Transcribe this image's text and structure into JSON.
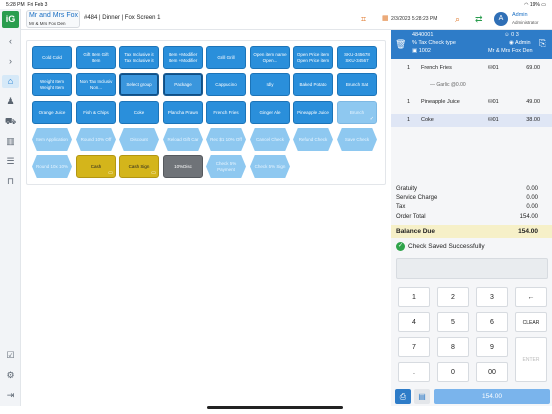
{
  "status_bar": {
    "time": "5:28 PM",
    "date": "Fri Feb 3",
    "battery": "19%"
  },
  "header": {
    "customer_name": "Mr and Mrs Fox",
    "customer_sub": "Mr & Mrs Fox Den",
    "order_info": "#484 | Dinner | Fox Screen 1",
    "datetime": "2/3/2023 5:28:23 PM",
    "avatar_initial": "A",
    "user_name": "Admin",
    "user_role": "Administrator"
  },
  "menu_tiles": [
    {
      "label": "Cold Cold",
      "style": "normal"
    },
    {
      "label": "Gift Item Gift Item",
      "style": "normal"
    },
    {
      "label": "Tax Inclusive it Tax Inclusive it",
      "style": "normal"
    },
    {
      "label": "Item +Modifier Item +Modifier",
      "style": "normal"
    },
    {
      "label": "Grill Grill",
      "style": "normal"
    },
    {
      "label": "Open item name Open...",
      "style": "normal"
    },
    {
      "label": "Open Price item Open Price item",
      "style": "normal"
    },
    {
      "label": "SKU-345678 SKU-34567",
      "style": "normal"
    },
    {
      "label": "Weight Item Weight Item",
      "style": "normal"
    },
    {
      "label": "Non Tax Inclusiv Non...",
      "style": "normal"
    },
    {
      "label": "Select group",
      "style": "outline"
    },
    {
      "label": "Package",
      "style": "outline"
    },
    {
      "label": "Cappucino",
      "style": "normal"
    },
    {
      "label": "Idly",
      "style": "normal"
    },
    {
      "label": "Baked Potato",
      "style": "normal"
    },
    {
      "label": "Brunch Sat",
      "style": "normal"
    },
    {
      "label": "Orange Juice",
      "style": "normal"
    },
    {
      "label": "Fish & Chips",
      "style": "normal"
    },
    {
      "label": "Coke",
      "style": "normal"
    },
    {
      "label": "Plancha Prawn",
      "style": "normal"
    },
    {
      "label": "French Fries",
      "style": "normal"
    },
    {
      "label": "Ginger Ale",
      "style": "normal"
    },
    {
      "label": "Pineapple Juice",
      "style": "normal"
    },
    {
      "label": "Brunch",
      "style": "light-check"
    },
    {
      "label": "Item Application",
      "style": "light-oct"
    },
    {
      "label": "Round 10% Off",
      "style": "light-oct"
    },
    {
      "label": "Discount",
      "style": "light-oct"
    },
    {
      "label": "Reload Gift Car",
      "style": "light-oct"
    },
    {
      "label": "Rec $1 10% Off",
      "style": "light-oct"
    },
    {
      "label": "Cancel Check",
      "style": "light-oct"
    },
    {
      "label": "Refund Check",
      "style": "light-oct"
    },
    {
      "label": "Save Check",
      "style": "light-oct"
    },
    {
      "label": "Round 10x 10%",
      "style": "light-oct"
    },
    {
      "label": "Cash",
      "style": "yellow"
    },
    {
      "label": "Cash Sign",
      "style": "yellow"
    },
    {
      "label": "10%Disc",
      "style": "gray"
    },
    {
      "label": "Check 5% Payment",
      "style": "light-oct"
    },
    {
      "label": "Check 5% Sign",
      "style": "light-oct"
    }
  ],
  "check": {
    "number": "4840001",
    "type": "% Tax Check type",
    "id": "1002",
    "counts": "0  3",
    "admin": "Admin",
    "location": "Mr & Mrs Fox Den"
  },
  "items": [
    {
      "qty": "1",
      "name": "French Fries",
      "seat": "01",
      "price": "69.00",
      "modifier": "Garlic @0.00"
    },
    {
      "qty": "1",
      "name": "Pineapple Juice",
      "seat": "01",
      "price": "49.00",
      "modifier": ""
    },
    {
      "qty": "1",
      "name": "Coke",
      "seat": "01",
      "price": "38.00",
      "modifier": ""
    }
  ],
  "totals": [
    {
      "label": "Gratuity",
      "value": "0.00"
    },
    {
      "label": "Service Charge",
      "value": "0.00"
    },
    {
      "label": "Tax",
      "value": "0.00"
    },
    {
      "label": "Order Total",
      "value": "154.00"
    }
  ],
  "balance": {
    "label": "Balance Due",
    "value": "154.00"
  },
  "message": "Check Saved Successfully",
  "keypad": [
    "1",
    "2",
    "3",
    "←",
    "4",
    "5",
    "6",
    "CLEAR",
    "7",
    "8",
    "9",
    "ENTER",
    ".",
    "0",
    "00"
  ],
  "pay_total": "154.00"
}
